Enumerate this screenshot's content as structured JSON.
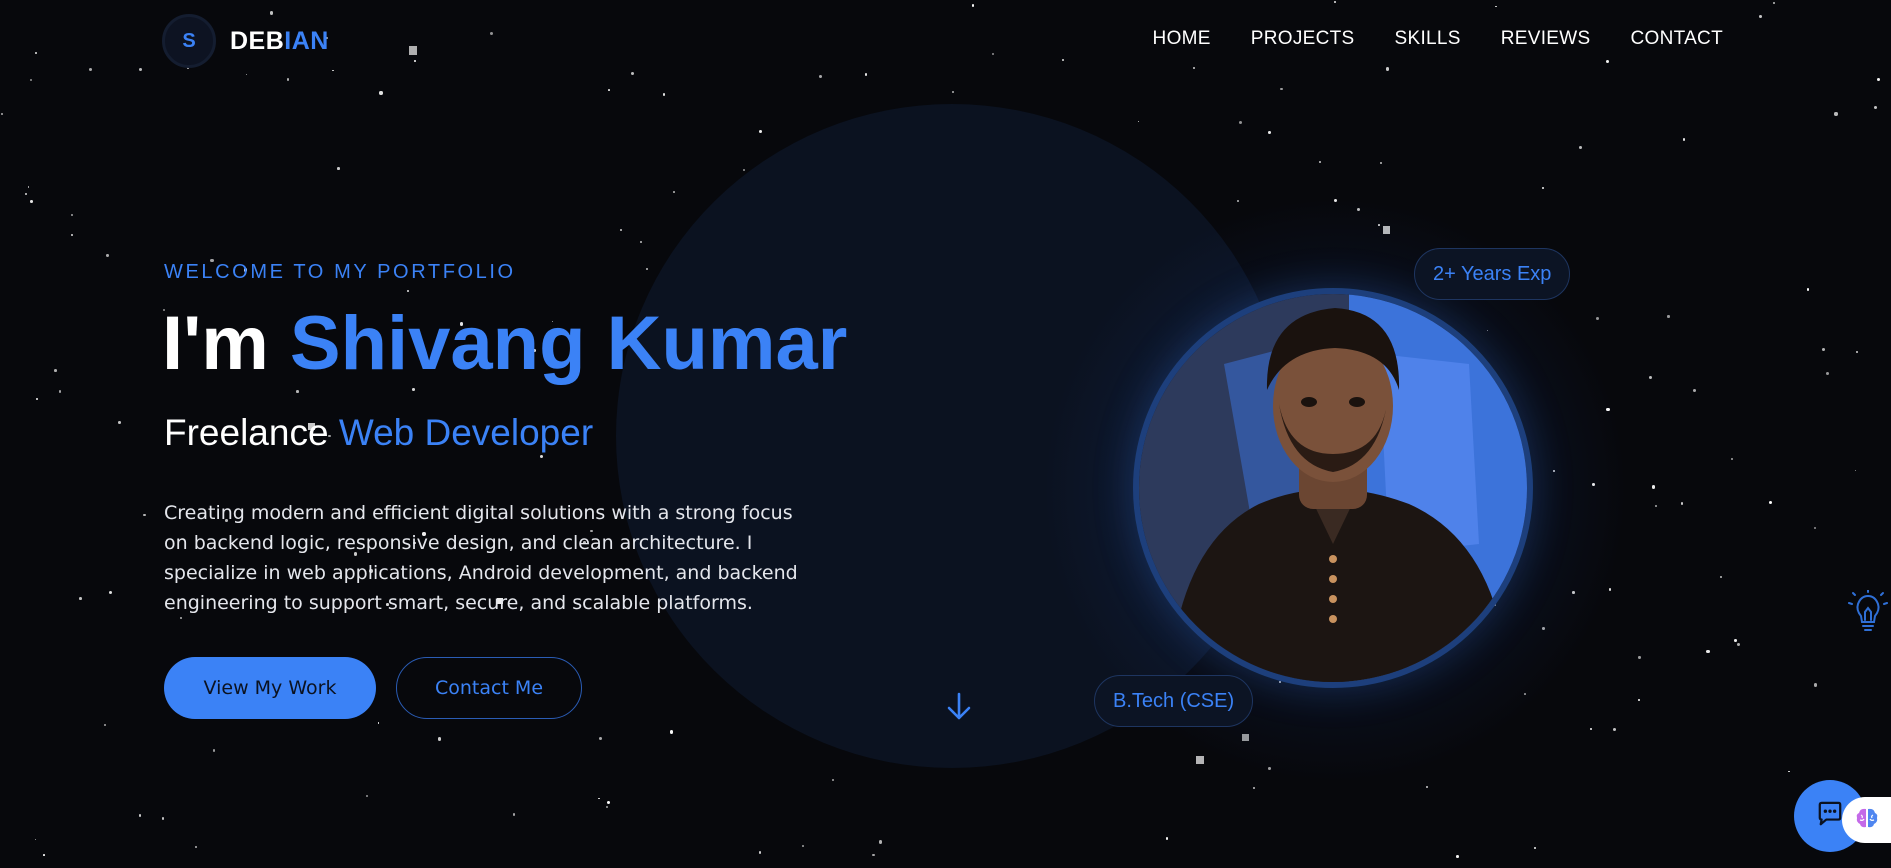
{
  "logo": {
    "badge": "S",
    "text_part1": "DEB",
    "text_part2": "IAN"
  },
  "nav": {
    "items": [
      "HOME",
      "PROJECTS",
      "SKILLS",
      "REVIEWS",
      "CONTACT"
    ]
  },
  "hero": {
    "welcome": "WELCOME TO MY PORTFOLIO",
    "title_prefix": "I'm ",
    "title_name": "Shivang Kumar",
    "subtitle_prefix": "Freelance ",
    "subtitle_highlight": "Web Developer",
    "description": "Creating modern and efficient digital solutions with a strong focus on backend logic, responsive design, and clean architecture. I specialize in web applications, Android development, and backend engineering to support smart, secure, and scalable platforms.",
    "primary_button": "View My Work",
    "secondary_button": "Contact Me"
  },
  "profile": {
    "badge_experience": "2+ Years Exp",
    "badge_education": "B.Tech (CSE)"
  },
  "icons": {
    "scroll": "arrow-down-icon",
    "idea": "lightbulb-icon",
    "chat": "chat-bubble-icon",
    "ai": "brain-icon"
  },
  "colors": {
    "accent": "#3b82f6",
    "background": "#07080c",
    "panel": "#0b1220"
  }
}
